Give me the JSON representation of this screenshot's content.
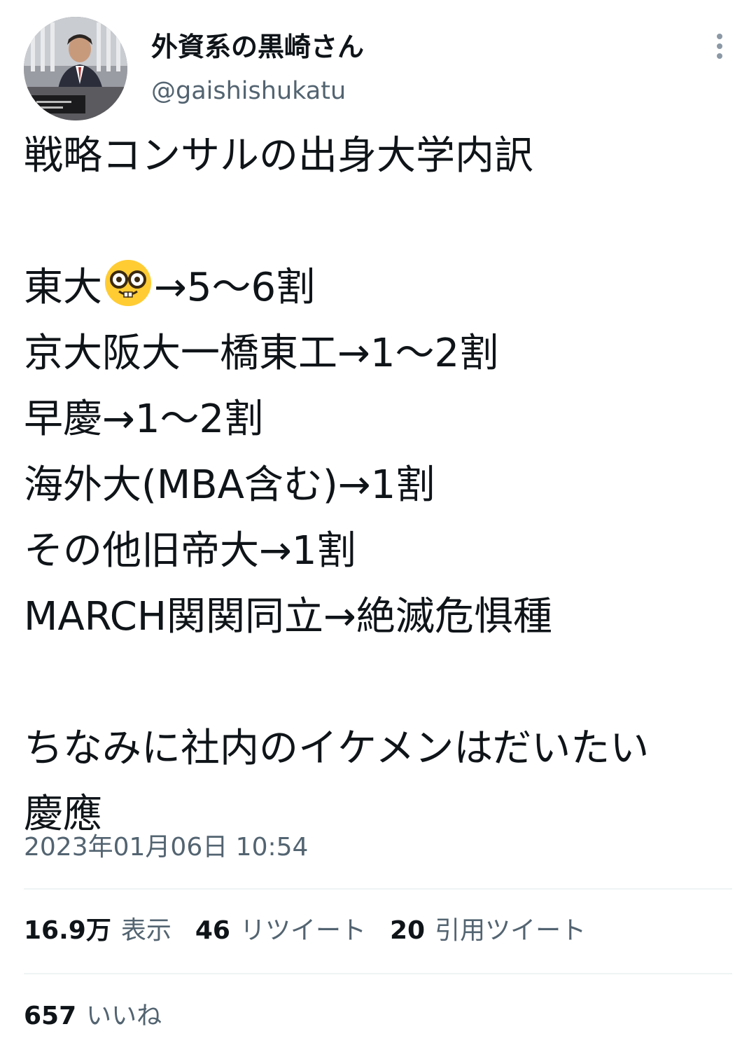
{
  "author": {
    "display_name": "外資系の黒崎さん",
    "handle": "@gaishishukatu",
    "avatar_icon": "avatar-photo"
  },
  "header": {
    "more_icon": "more-vertical-icon"
  },
  "tweet": {
    "lines": [
      "戦略コンサルの出身大学内訳",
      "",
      "東大",
      "京大阪大一橋東工→1〜2割",
      "早慶→1〜2割",
      "海外大(MBA含む)→1割",
      "その他旧帝大→1割",
      "MARCH関関同立→絶滅危惧種",
      "",
      "ちなみに社内のイケメンはだいたい",
      "慶應"
    ],
    "line3_suffix": "→5〜6割",
    "emoji_icon": "nerd-face-emoji"
  },
  "timestamp": "2023年01月06日 10:54",
  "stats": {
    "views_count": "16.9万",
    "views_label": "表示",
    "retweets_count": "46",
    "retweets_label": "リツイート",
    "quotes_count": "20",
    "quotes_label": "引用ツイート",
    "likes_count": "657",
    "likes_label": "いいね"
  },
  "colors": {
    "text_primary": "#0f1419",
    "text_secondary": "#536471",
    "divider": "#eff3f4",
    "emoji_face": "#ffcc33"
  }
}
